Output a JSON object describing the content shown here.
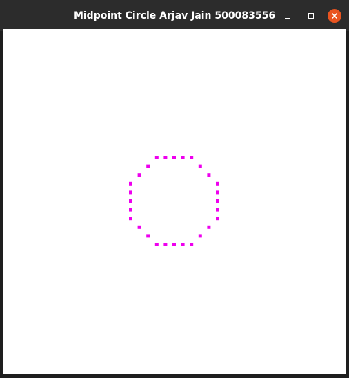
{
  "window": {
    "title": "Midpoint Circle Arjav Jain 500083556",
    "minimize_icon": "minimize-icon",
    "maximize_icon": "maximize-icon",
    "close_icon": "close-icon",
    "close_color": "#e95420"
  },
  "canvas": {
    "background": "#ffffff",
    "axis_color": "#cc0000",
    "point_color": "#ee00ee",
    "circle_center": [
      0,
      0
    ],
    "circle_radius": 5
  }
}
